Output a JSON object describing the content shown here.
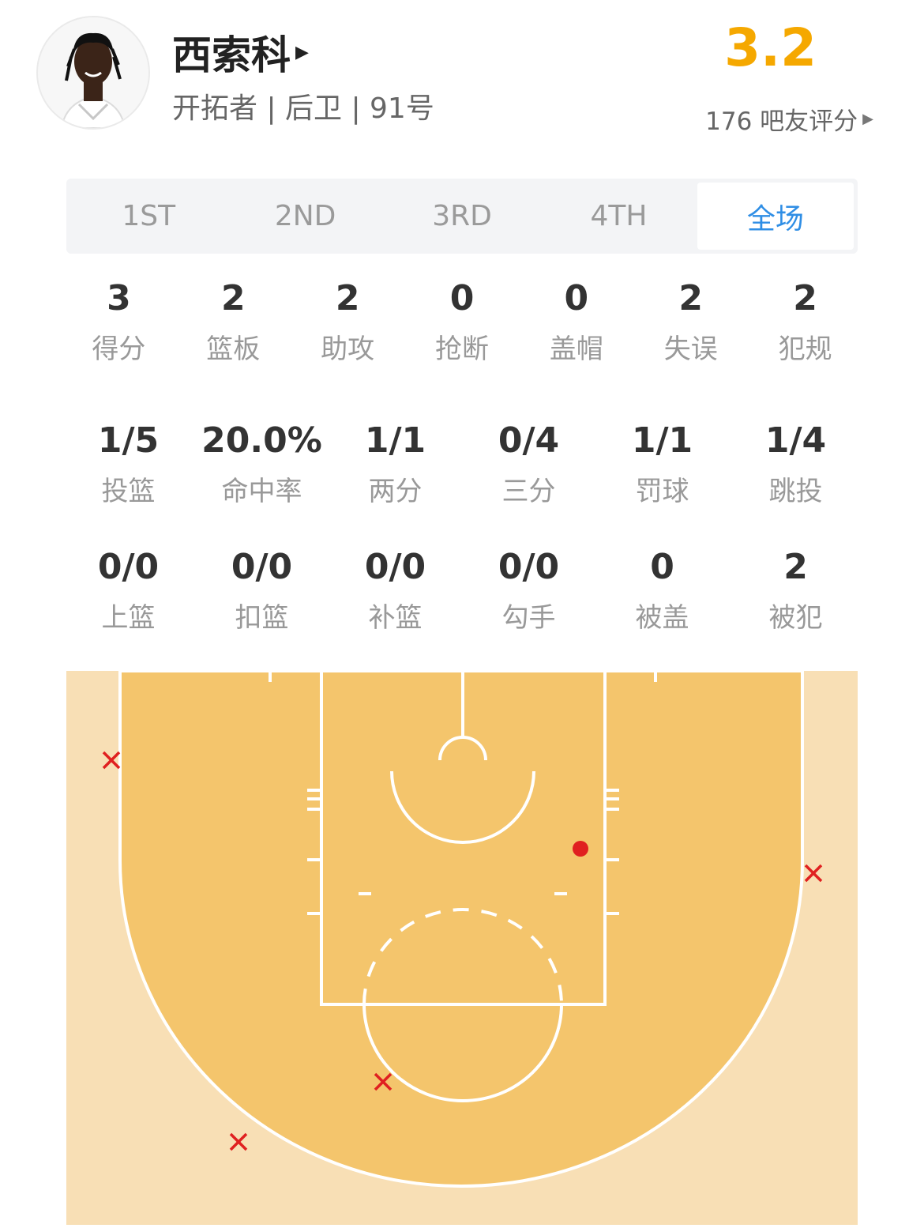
{
  "player": {
    "name": "西索科",
    "meta": "开拓者 | 后卫 | 91号",
    "rating": "3.2",
    "rating_count": "176 吧友评分"
  },
  "tabs": [
    {
      "label": "1ST",
      "active": false
    },
    {
      "label": "2ND",
      "active": false
    },
    {
      "label": "3RD",
      "active": false
    },
    {
      "label": "4TH",
      "active": false
    },
    {
      "label": "全场",
      "active": true
    }
  ],
  "stats_main": [
    {
      "value": "3",
      "label": "得分"
    },
    {
      "value": "2",
      "label": "篮板"
    },
    {
      "value": "2",
      "label": "助攻"
    },
    {
      "value": "0",
      "label": "抢断"
    },
    {
      "value": "0",
      "label": "盖帽"
    },
    {
      "value": "2",
      "label": "失误"
    },
    {
      "value": "2",
      "label": "犯规"
    }
  ],
  "stats_shooting": [
    {
      "value": "1/5",
      "label": "投篮"
    },
    {
      "value": "20.0%",
      "label": "命中率"
    },
    {
      "value": "1/1",
      "label": "两分"
    },
    {
      "value": "0/4",
      "label": "三分"
    },
    {
      "value": "1/1",
      "label": "罚球"
    },
    {
      "value": "1/4",
      "label": "跳投"
    }
  ],
  "stats_detail": [
    {
      "value": "0/0",
      "label": "上篮"
    },
    {
      "value": "0/0",
      "label": "扣篮"
    },
    {
      "value": "0/0",
      "label": "补篮"
    },
    {
      "value": "0/0",
      "label": "勾手"
    },
    {
      "value": "0",
      "label": "被盖"
    },
    {
      "value": "2",
      "label": "被犯"
    }
  ],
  "shot_chart": {
    "colors": {
      "outer": "#f8dfb5",
      "inner": "#f4c56c",
      "made": "#e02020",
      "missed": "#e02020",
      "lines": "#ffffff"
    },
    "shots": [
      {
        "result": "made"
      },
      {
        "result": "missed"
      },
      {
        "result": "missed"
      },
      {
        "result": "missed"
      },
      {
        "result": "missed"
      }
    ]
  }
}
